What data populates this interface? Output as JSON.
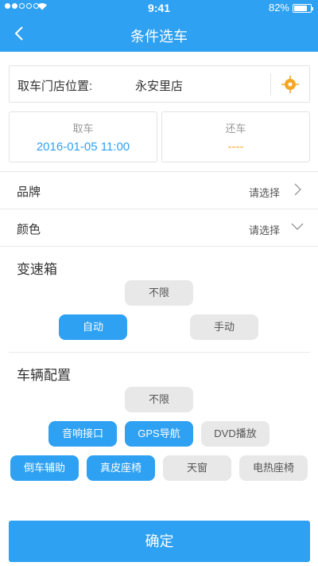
{
  "status_bar": {
    "time": "9:41",
    "battery": "82%"
  },
  "nav": {
    "title": "条件选车"
  },
  "pickup_store": {
    "label": "取车门店位置:",
    "value": "永安里店"
  },
  "pickup": {
    "label": "取车",
    "value": "2016-01-05 11:00"
  },
  "return": {
    "label": "还车",
    "value": "----"
  },
  "brand": {
    "label": "品牌",
    "value": "请选择"
  },
  "color": {
    "label": "颜色",
    "value": "请选择"
  },
  "transmission": {
    "title": "变速箱",
    "options": [
      {
        "label": "不限",
        "selected": false
      },
      {
        "label": "自动",
        "selected": true
      },
      {
        "label": "手动",
        "selected": false
      }
    ]
  },
  "config": {
    "title": "车辆配置",
    "options": [
      {
        "label": "不限",
        "selected": false
      },
      {
        "label": "音响接口",
        "selected": true
      },
      {
        "label": "GPS导航",
        "selected": true
      },
      {
        "label": "DVD播放",
        "selected": false
      },
      {
        "label": "倒车辅助",
        "selected": true
      },
      {
        "label": "真皮座椅",
        "selected": true
      },
      {
        "label": "天窗",
        "selected": false
      },
      {
        "label": "电热座椅",
        "selected": false
      }
    ]
  },
  "confirm_label": "确定",
  "colors": {
    "accent": "#2ea1f2",
    "return_value": "#f5a623",
    "chip_off": "#e8e8e8"
  }
}
